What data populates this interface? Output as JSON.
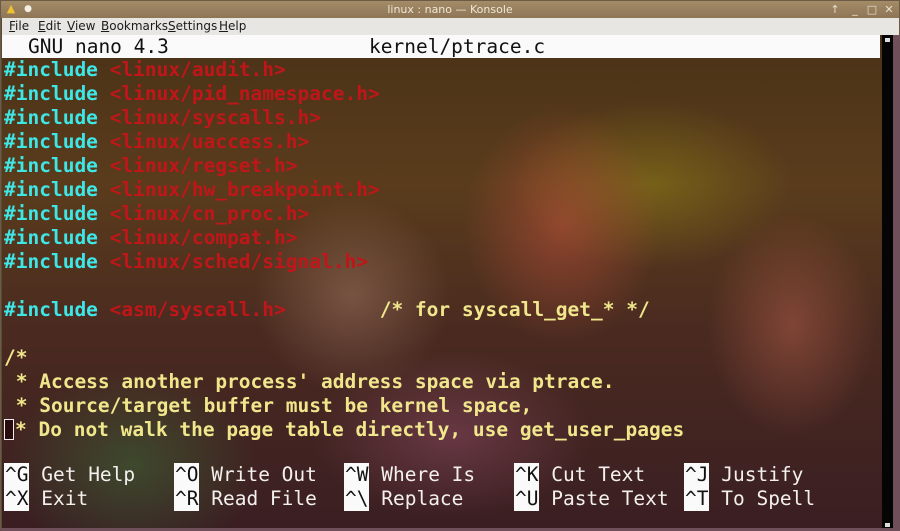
{
  "window": {
    "title": "linux : nano — Konsole",
    "app_icon": "tux-icon",
    "buttons": [
      "keep-above",
      "minimize",
      "maximize",
      "close"
    ]
  },
  "menubar": {
    "items": [
      {
        "label": "File",
        "mnemonic": "F",
        "rest": "ile"
      },
      {
        "label": "Edit",
        "mnemonic": "E",
        "rest": "dit"
      },
      {
        "label": "View",
        "mnemonic": "V",
        "rest": "iew"
      },
      {
        "label": "Bookmarks",
        "mnemonic": "B",
        "rest": "ookmarks"
      },
      {
        "label": "Settings",
        "mnemonic": "S",
        "rest": "ettings"
      },
      {
        "label": "Help",
        "mnemonic": "H",
        "rest": "elp"
      }
    ]
  },
  "nano": {
    "version_label": "GNU nano 4.3",
    "filename": "kernel/ptrace.c",
    "lines": [
      {
        "kw": "#include",
        "str": "<linux/audit.h>",
        "cmt": ""
      },
      {
        "kw": "#include",
        "str": "<linux/pid_namespace.h>",
        "cmt": ""
      },
      {
        "kw": "#include",
        "str": "<linux/syscalls.h>",
        "cmt": ""
      },
      {
        "kw": "#include",
        "str": "<linux/uaccess.h>",
        "cmt": ""
      },
      {
        "kw": "#include",
        "str": "<linux/regset.h>",
        "cmt": ""
      },
      {
        "kw": "#include",
        "str": "<linux/hw_breakpoint.h>",
        "cmt": ""
      },
      {
        "kw": "#include",
        "str": "<linux/cn_proc.h>",
        "cmt": ""
      },
      {
        "kw": "#include",
        "str": "<linux/compat.h>",
        "cmt": ""
      },
      {
        "kw": "#include",
        "str": "<linux/sched/signal.h>",
        "cmt": ""
      },
      {
        "kw": "",
        "str": "",
        "cmt": ""
      },
      {
        "kw": "#include",
        "str": "<asm/syscall.h>",
        "cmt": "        /* for syscall_get_* */"
      },
      {
        "kw": "",
        "str": "",
        "cmt": ""
      },
      {
        "kw": "",
        "str": "",
        "cmt": "/*"
      },
      {
        "kw": "",
        "str": "",
        "cmt": " * Access another process' address space via ptrace."
      },
      {
        "kw": "",
        "str": "",
        "cmt": " * Source/target buffer must be kernel space,"
      },
      {
        "kw": "",
        "str": "",
        "cmt": "* Do not walk the page table directly, use get_user_pages"
      }
    ],
    "shortcuts": [
      {
        "key": "^G",
        "label": "Get Help"
      },
      {
        "key": "^O",
        "label": "Write Out"
      },
      {
        "key": "^W",
        "label": "Where Is"
      },
      {
        "key": "^K",
        "label": "Cut Text"
      },
      {
        "key": "^J",
        "label": "Justify"
      },
      {
        "key": "^X",
        "label": "Exit"
      },
      {
        "key": "^R",
        "label": "Read File"
      },
      {
        "key": "^\\",
        "label": "Replace"
      },
      {
        "key": "^U",
        "label": "Paste Text"
      },
      {
        "key": "^T",
        "label": "To Spell"
      }
    ]
  },
  "colors": {
    "preprocessor": "#3ee6e6",
    "string": "#c0161a",
    "comment": "#f0e68c",
    "header_bg": "#fafafa",
    "titlebar": "#9a8260"
  }
}
